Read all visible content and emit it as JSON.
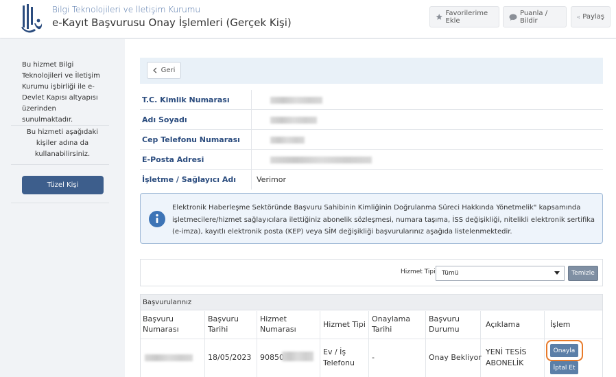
{
  "header": {
    "org_name": "Bilgi Teknolojileri ve İletişim Kurumu",
    "page_title": "e-Kayıt Başvurusu Onay İşlemleri (Gerçek Kişi)",
    "favorite_label": "Favorilerime Ekle",
    "rate_label": "Puanla / Bildir",
    "share_label": "Paylaş",
    "brand_color": "#2b4c7e"
  },
  "sidebar": {
    "info_text": "Bu hizmet Bilgi Teknolojileri ve İletişim Kurumu işbirliği ile e-Devlet Kapısı altyapısı üzerinden sunulmaktadır.",
    "usage_text": "Bu hizmeti aşağıdaki kişiler adına da kullanabilirsiniz.",
    "tuzel_label": "Tüzel Kişi",
    "button_color": "#3d5e8c"
  },
  "main": {
    "back_label": "Geri",
    "info_rows": [
      {
        "label": "T.C. Kimlik Numarası",
        "value": ""
      },
      {
        "label": "Adı Soyadı",
        "value": ""
      },
      {
        "label": "Cep Telefonu Numarası",
        "value": ""
      },
      {
        "label": "E-Posta Adresi",
        "value": ""
      },
      {
        "label": "İşletme / Sağlayıcı Adı",
        "value": "Verimor"
      }
    ],
    "notice": "Elektronik Haberleşme Sektöründe Başvuru Sahibinin Kimliğinin Doğrulanma Süreci Hakkında Yönetmelik\" kapsamında işletmecilere/hizmet sağlayıcılara ilettiğiniz abonelik sözleşmesi, numara taşıma, İSS değişikliği, nitelikli elektronik sertifika (e-imza), kayıtlı elektronik posta (KEP) veya SİM değişikliği başvurularınız aşağıda listelenmektedir.",
    "filter": {
      "label": "Hizmet Tipi",
      "selected": "Tümü",
      "clear_label": "Temizle"
    },
    "applications": {
      "title": "Başvurularınız",
      "columns": [
        "Başvuru Numarası",
        "Başvuru Tarihi",
        "Hizmet Numarası",
        "Hizmet Tipi",
        "Onaylama Tarihi",
        "Başvuru Durumu",
        "Açıklama",
        "İşlem"
      ],
      "rows": [
        {
          "number": "",
          "date": "18/05/2023",
          "service_number": "90850",
          "service_type": "Ev / İş Telefonu",
          "approval_date": "-",
          "status": "Onay Bekliyor",
          "description": "YENİ TESİS ABONELİK",
          "approve_label": "Onayla",
          "cancel_label": "İptal Et"
        }
      ]
    },
    "highlight_color": "#e87a2a"
  }
}
